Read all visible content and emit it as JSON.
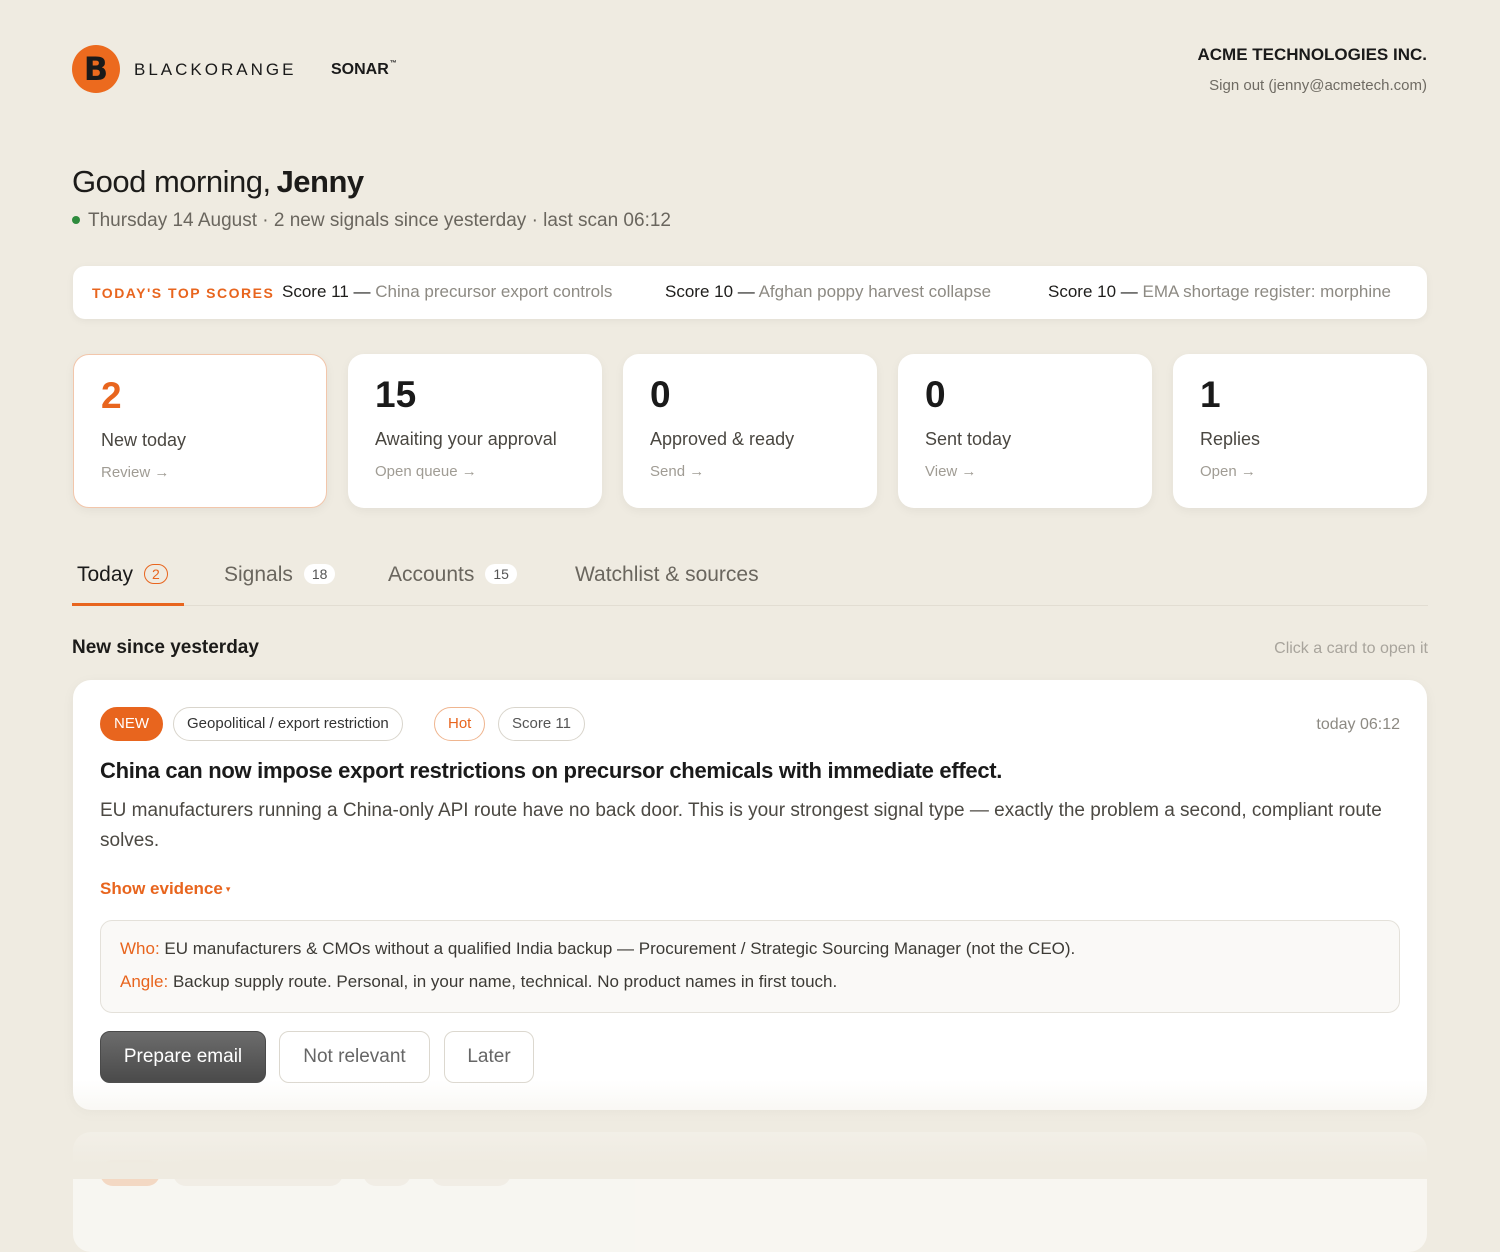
{
  "header": {
    "logo_letter": "B",
    "brand": "BLACKORANGE",
    "product": "SONAR",
    "product_mark": "™",
    "company": "ACME TECHNOLOGIES INC.",
    "signout": "Sign out (jenny@acmetech.com)"
  },
  "greeting": {
    "prefix": "Good morning,",
    "name": "Jenny",
    "subline": "Thursday 14 August · 2 new signals since yesterday · last scan 06:12",
    "status_color": "#2e8b3d"
  },
  "top_scores": {
    "label": "TODAY'S TOP SCORES",
    "items": [
      {
        "score": "Score 11 —",
        "text": "China precursor export controls"
      },
      {
        "score": "Score 10 —",
        "text": "Afghan poppy harvest collapse"
      },
      {
        "score": "Score 10 —",
        "text": "EMA shortage register: morphine"
      }
    ]
  },
  "stats": [
    {
      "value": "2",
      "label": "New today",
      "action": "Review →"
    },
    {
      "value": "15",
      "label": "Awaiting your approval",
      "action": "Open queue →"
    },
    {
      "value": "0",
      "label": "Approved & ready",
      "action": "Send →"
    },
    {
      "value": "0",
      "label": "Sent today",
      "action": "View →"
    },
    {
      "value": "1",
      "label": "Replies",
      "action": "Open →"
    }
  ],
  "tabs": [
    {
      "label": "Today",
      "count": "2"
    },
    {
      "label": "Signals",
      "count": "18"
    },
    {
      "label": "Accounts",
      "count": "15"
    },
    {
      "label": "Watchlist & sources"
    }
  ],
  "section": {
    "title": "New since yesterday",
    "hint": "Click a card to open it"
  },
  "card": {
    "tags": [
      "NEW",
      "Geopolitical / export restriction",
      "Hot",
      "Score 11"
    ],
    "time": "today 06:12",
    "title": "China can now impose export restrictions on precursor chemicals with immediate effect.",
    "body": "EU manufacturers running a China-only API route have no back door. This is your strongest signal type — exactly the problem a second, compliant route solves.",
    "evidence_label": "Show evidence",
    "evidence_caret": "▾",
    "who_label": "Who:",
    "who_text": "EU manufacturers & CMOs without a qualified India backup — Procurement / Strategic Sourcing Manager (not the CEO).",
    "angle_label": "Angle:",
    "angle_text": "Backup supply route. Personal, in your name, technical. No product names in first touch.",
    "buttons": {
      "primary": "Prepare email",
      "not_relevant": "Not relevant",
      "later": "Later"
    }
  },
  "colors": {
    "accent": "#e8651e",
    "background": "#efebe1",
    "card": "#ffffff"
  }
}
